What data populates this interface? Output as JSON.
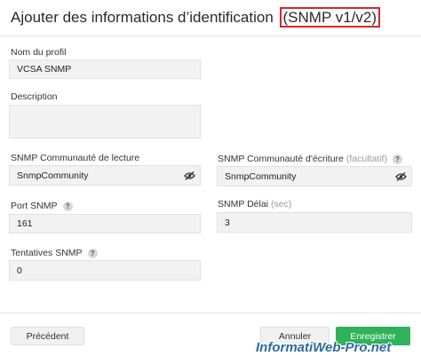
{
  "dialog": {
    "title": "Ajouter des informations d’identification",
    "title_highlight": "(SNMP v1/v2)"
  },
  "form": {
    "profile_name": {
      "label": "Nom du profil",
      "value": "VCSA SNMP"
    },
    "description": {
      "label": "Description",
      "value": ""
    },
    "read_community": {
      "label": "SNMP Communauté de lecture",
      "value": "SnmpCommunity"
    },
    "write_community": {
      "label": "SNMP Communauté d'écriture",
      "optional_hint": "(facultatif)",
      "value": "SnmpCommunity"
    },
    "port": {
      "label": "Port SNMP",
      "value": "161"
    },
    "timeout": {
      "label": "SNMP Délai",
      "hint": "(sec)",
      "value": "3"
    },
    "retries": {
      "label": "Tentatives SNMP",
      "value": "0"
    },
    "help_glyph": "?"
  },
  "buttons": {
    "previous": "Précédent",
    "cancel": "Annuler",
    "save": "Enregistrer"
  },
  "watermark": "InformatiWeb-Pro.net",
  "colors": {
    "highlight_border": "#d8262c",
    "primary_button": "#2fb25a"
  },
  "icons": {
    "password_toggle": "eye-slash-icon",
    "help": "question-circle-icon"
  }
}
